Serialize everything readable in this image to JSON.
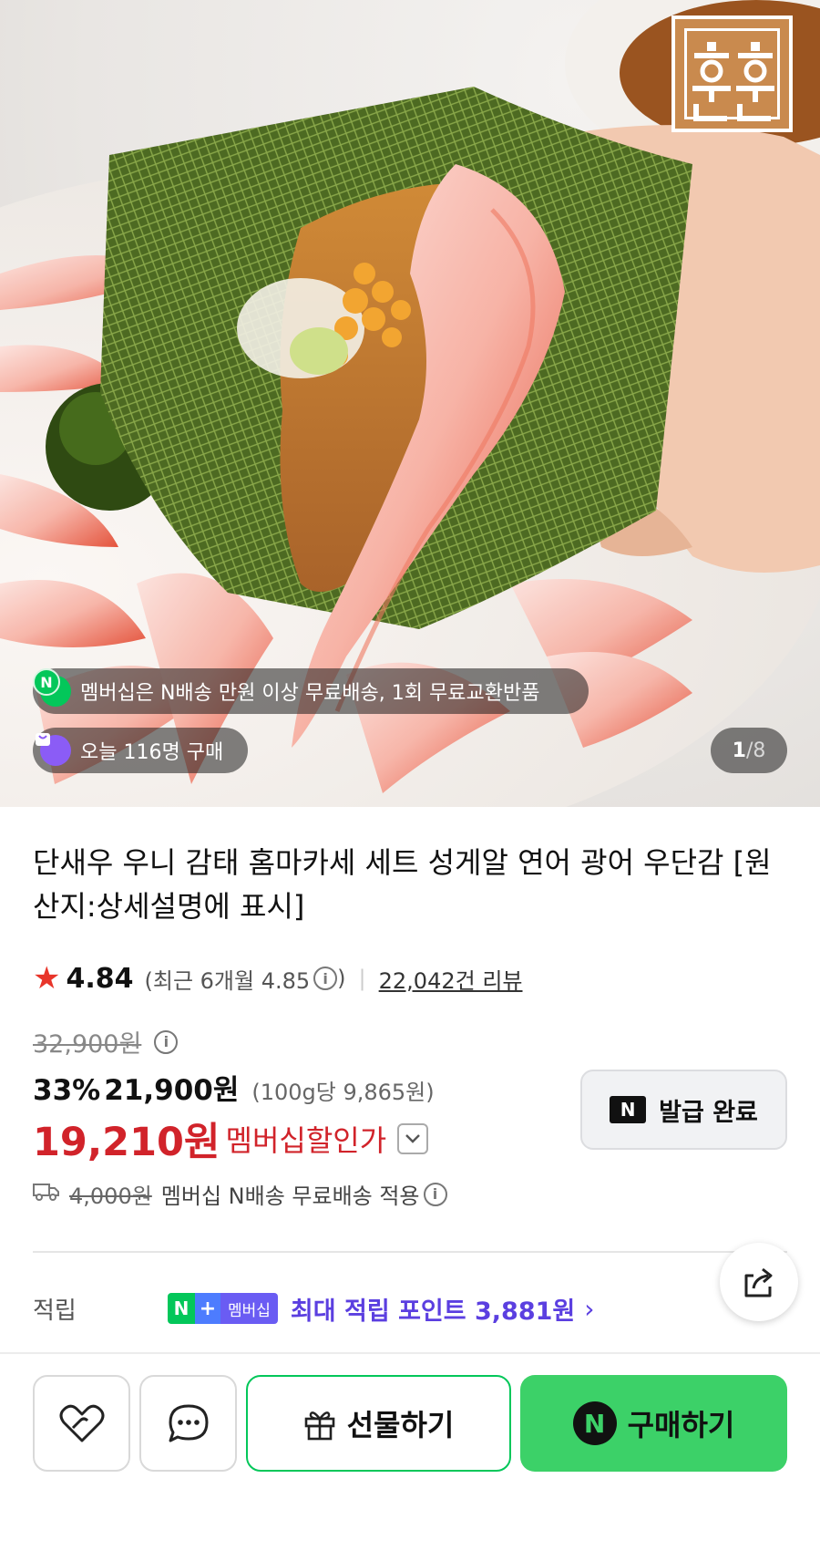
{
  "hero": {
    "brand_logo_text": "훈훈",
    "membership_notice": "멤버십은 N배송 만원 이상 무료배송, 1회 무료교환반품",
    "today_buyers": "오늘 116명 구매",
    "pager_current": "1",
    "pager_total": "/8"
  },
  "product": {
    "title": "단새우 우니 감태 홈마카세 세트 성게알 연어 광어 우단감 [원산지:상세설명에 표시]",
    "rating": "4.84",
    "recent_rating_prefix": "(최근 6개월 4.85",
    "recent_rating_suffix": ")",
    "review_count": "22,042건 리뷰"
  },
  "price": {
    "original": "32,900원",
    "discount_rate": "33%",
    "sale": "21,900원",
    "unit_price": "(100g당 9,865원)",
    "member_price": "19,210원",
    "member_label": "멤버십할인가"
  },
  "coupon": {
    "label": "발급 완료",
    "n_mark": "N"
  },
  "shipping": {
    "original_fee": "4,000원",
    "text": "멤버십 N배송 무료배송 적용"
  },
  "points": {
    "label": "적립",
    "badge_n": "N",
    "badge_plus": "+",
    "badge_member": "멤버십",
    "text": "최대 적립 포인트 3,881원",
    "arrow": "›"
  },
  "actions": {
    "gift_label": "선물하기",
    "buy_label": "구매하기",
    "buy_n_mark": "N"
  },
  "colors": {
    "accent_red": "#d1232a",
    "naver_green": "#03c75a",
    "buy_green": "#3cd168",
    "member_purple": "#5b3fe0",
    "star_red": "#e8352a"
  },
  "icons": {
    "star": "star-icon",
    "info": "info-icon",
    "truck": "truck-icon",
    "share": "share-icon",
    "like": "heart-icon",
    "talk": "chat-bubble-icon",
    "gift": "gift-icon",
    "chevron": "chevron-down-icon"
  }
}
